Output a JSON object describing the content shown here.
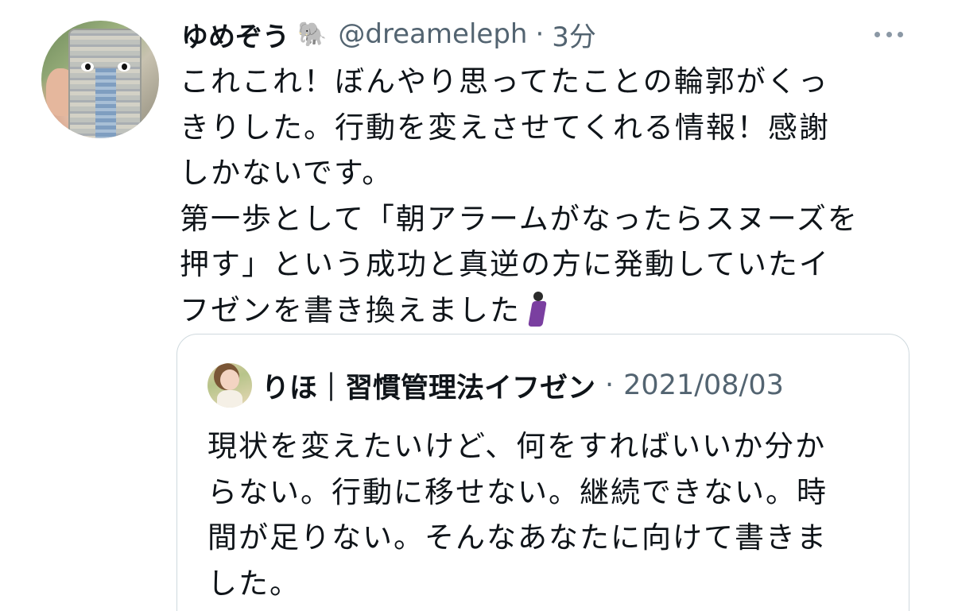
{
  "tweet": {
    "display_name": "ゆめぞう",
    "name_emoji": "🐘",
    "handle": "@dreameleph",
    "separator": "·",
    "time": "3分",
    "more_icon": "more-horizontal-icon",
    "body_lines": [
      "これこれ！ぼんやり思ってたことの輪郭がくっ",
      "きりした。行動を変えさせてくれる情報！感謝",
      "しかないです。",
      "第一歩として「朝アラームがなったらスヌーズを",
      "押す」という成功と真逆の方に発動していたイ",
      "フゼンを書き換えました"
    ],
    "body_end_emoji": "man-dancing-emoji"
  },
  "quoted_tweet": {
    "display_name": "りほ｜習慣管理法イフゼン",
    "separator": "·",
    "date": "2021/08/03",
    "body_lines": [
      "現状を変えたいけど、何をすればいいか分か",
      "らない。行動に移せない。継続できない。時",
      "間が足りない。そんなあなたに向けて書きま",
      "した。"
    ]
  }
}
